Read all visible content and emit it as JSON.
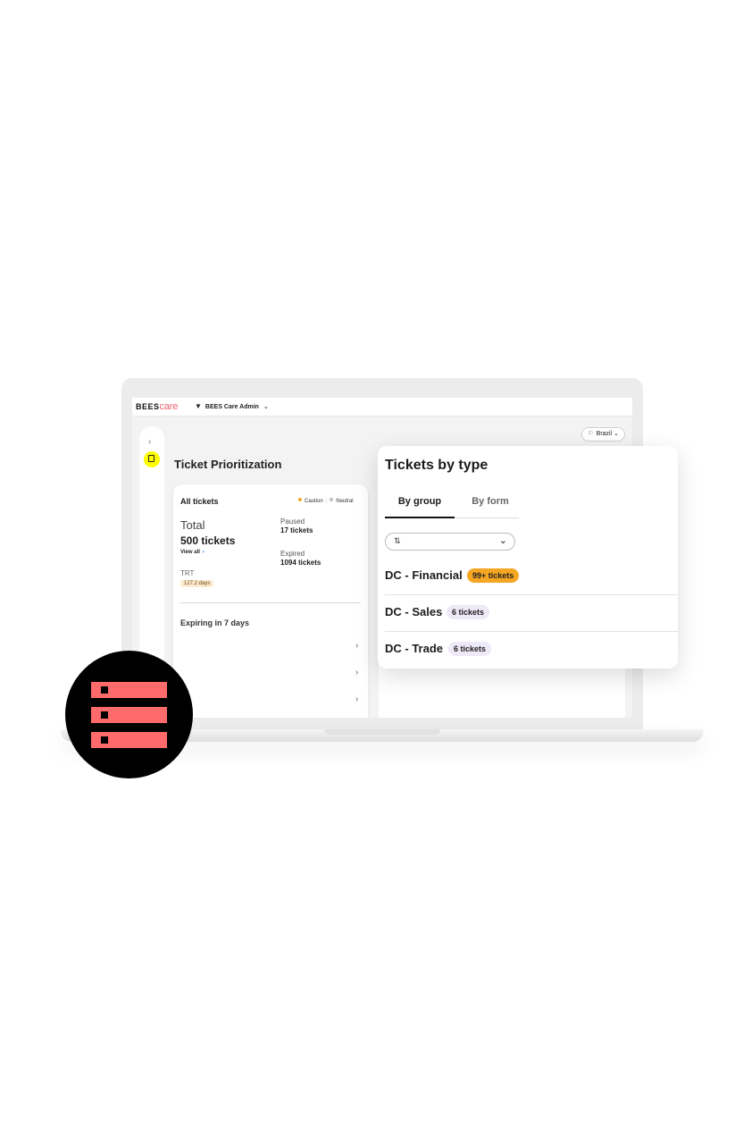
{
  "colors": {
    "brand_care": "#f0606e",
    "sidebar_active": "#ffff00",
    "caution": "#f5a623",
    "neutral": "#bdbdbd",
    "badge_financial": "#f5a623",
    "badge_default": "#eee9f7",
    "icon_accent": "#ff6b6b",
    "icon_background": "#000000"
  },
  "header": {
    "logo_bees": "BEES",
    "logo_care": "care",
    "app_switcher_label": "BEES Care Admin",
    "country_label": "Brazil"
  },
  "sidebar": {
    "expand_icon": "chevron-right-icon",
    "active_item_icon": "ticket-icon"
  },
  "ticket_prioritization": {
    "title": "Ticket Prioritization",
    "all_tickets_card": {
      "title": "All tickets",
      "legend": [
        "Caution",
        "Neutral"
      ],
      "total_label": "Total",
      "total_value": "500 tickets",
      "view_all": "View all",
      "paused_label": "Paused",
      "paused_value": "17 tickets",
      "expired_label": "Expired",
      "expired_value": "1094 tickets",
      "trt_label": "TRT",
      "trt_value": "127.2 days",
      "expiring_title": "Expiring in 7 days"
    }
  },
  "tickets_by_type": {
    "title": "Tickets by type",
    "tabs": [
      {
        "label": "By group",
        "active": true
      },
      {
        "label": "By form",
        "active": false
      }
    ],
    "sort_select_value": "",
    "groups": [
      {
        "name": "DC - Financial",
        "badge": "99+ tickets"
      },
      {
        "name": "DC - Sales",
        "badge": "6 tickets"
      },
      {
        "name": "DC - Trade",
        "badge": "6 tickets"
      }
    ]
  },
  "feature_icon": "server-rack-icon"
}
